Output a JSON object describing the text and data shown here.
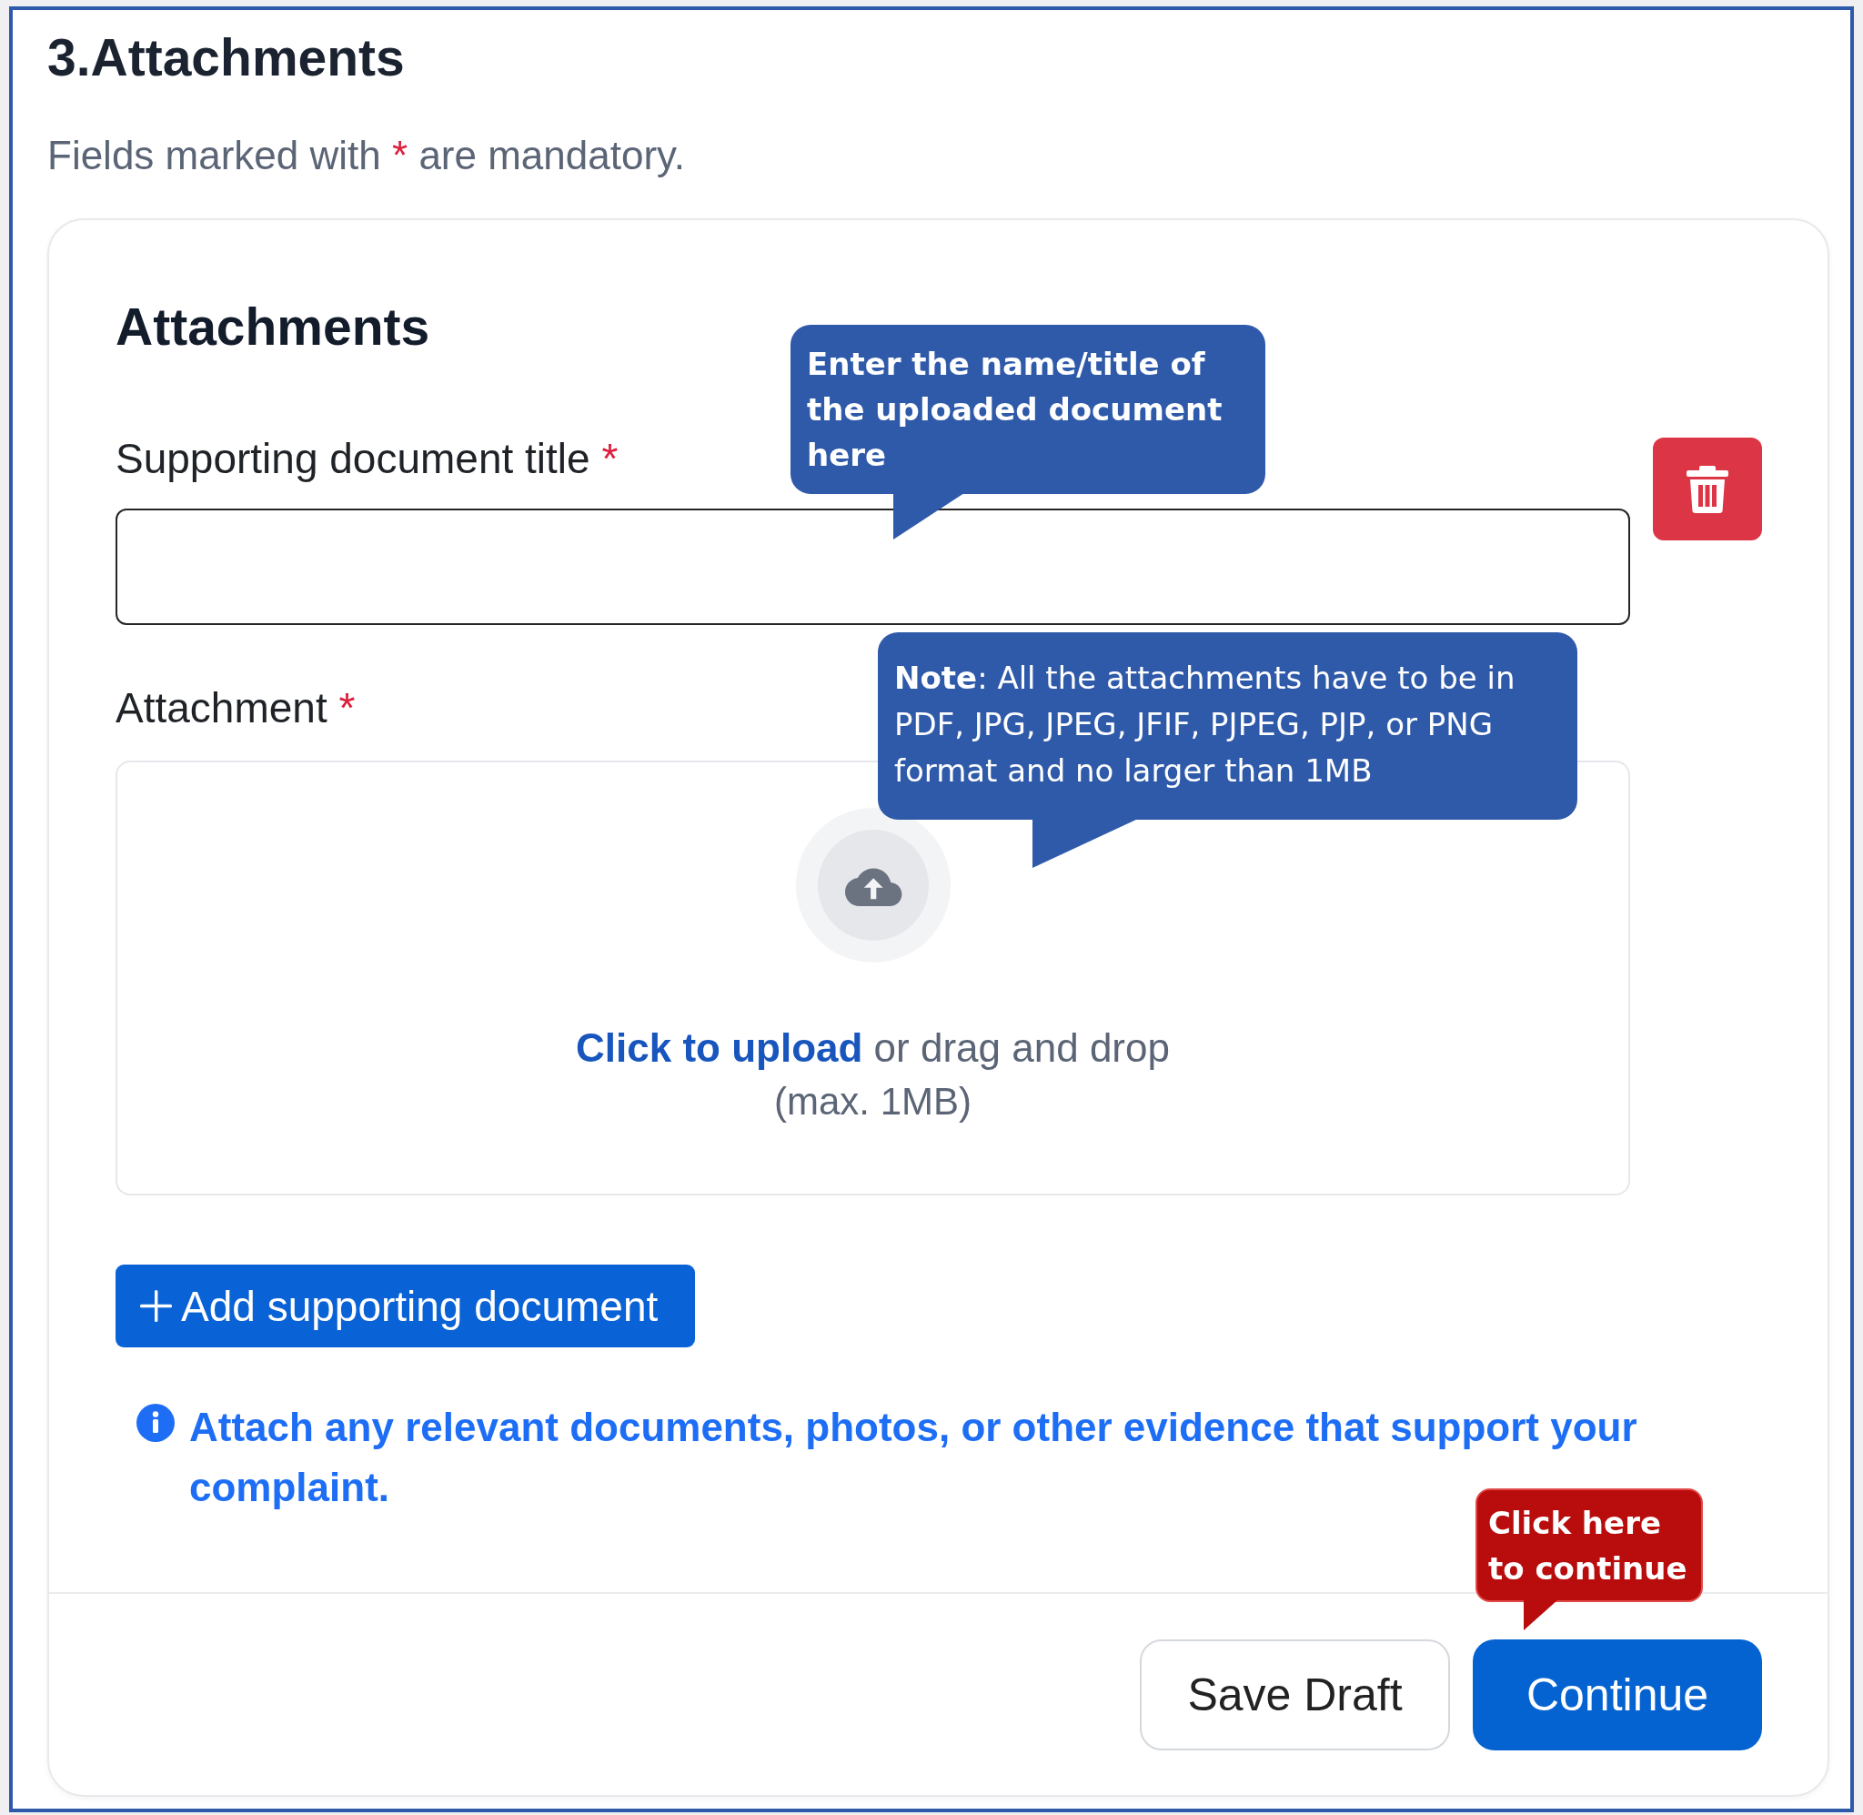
{
  "header": {
    "title": "3.Attachments",
    "note": [
      {
        "kind": "text",
        "text": "Fields marked with"
      },
      {
        "kind": "required",
        "text": "*"
      },
      {
        "kind": "text",
        "text": "are mandatory."
      }
    ]
  },
  "card": {
    "title": "Attachments",
    "documents": [
      {
        "removable": true,
        "title_field": {
          "label": "Supporting document title",
          "required_mark": "*",
          "callout": {
            "kind": "tip",
            "text": "Enter the name/title of the uploaded document here"
          }
        },
        "attachment_field": {
          "label": "Attachment",
          "required_mark": "*",
          "upload_link": "Click to upload",
          "upload_text": "or drag and drop",
          "size_limit": "(max. 1MB)",
          "callout": {
            "kind": "note",
            "text": "**Note**: All the attachments have to be in PDF, JPG, JPEG, JFIF, PJPEG, PJP, or PNG format and no larger than 1MB"
          }
        }
      }
    ],
    "add_button": {
      "label": "Add supporting document"
    },
    "info": "Attach any relevant documents, photos, or other evidence that support your complaint."
  },
  "footer": {
    "buttons": [
      {
        "kind": "secondary",
        "label": "Save Draft"
      },
      {
        "kind": "primary",
        "label": "Continue",
        "callout": {
          "kind": "alert",
          "text": "Click here to continue"
        }
      }
    ]
  }
}
